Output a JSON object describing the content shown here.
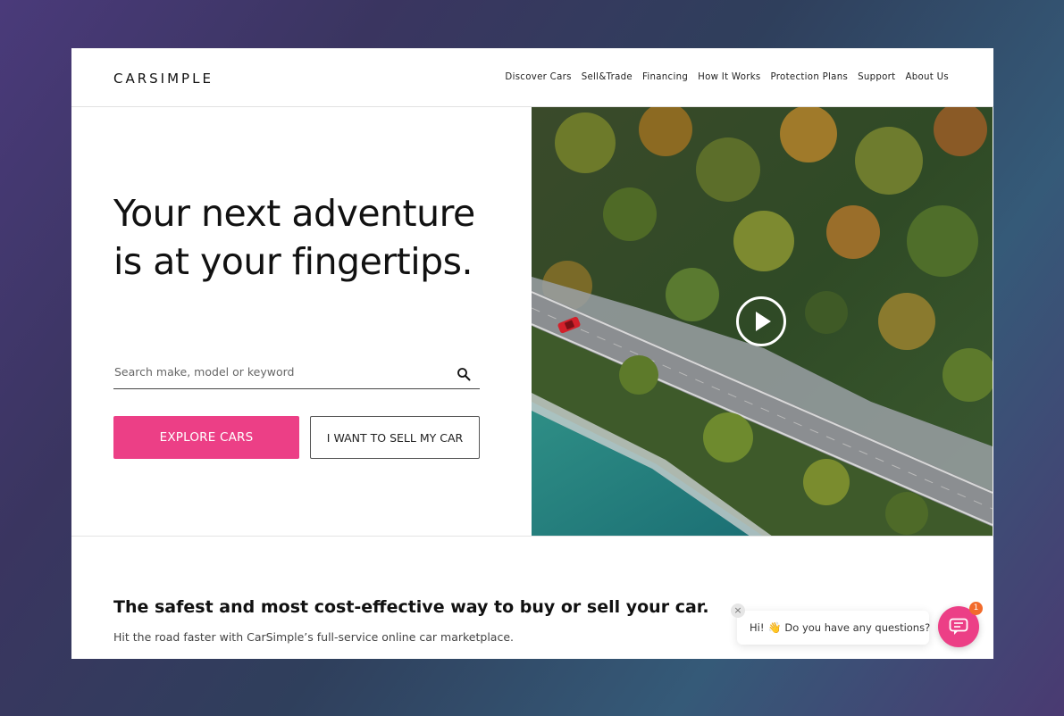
{
  "header": {
    "logo": "CARSIMPLE",
    "nav": [
      "Discover Cars",
      "Sell&Trade",
      "Financing",
      "How It Works",
      "Protection Plans",
      "Support",
      "About Us"
    ]
  },
  "hero": {
    "headline": "Your next adventure is at your fingertips.",
    "search": {
      "placeholder": "Search make, model or keyword",
      "value": ""
    },
    "explore_button": "EXPLORE CARS",
    "sell_button": "I WANT TO SELL MY CAR",
    "media": {
      "icon": "play-icon"
    }
  },
  "section": {
    "tagline": "The safest and most cost-effective way to buy or sell your car.",
    "subtext": "Hit the road faster with CarSimple’s full-service online car marketplace."
  },
  "chat": {
    "greeting_prefix": "Hi!",
    "greeting_emoji": "👋",
    "greeting_text": "Do you have any questions?",
    "badge_count": "1",
    "close_glyph": "×"
  },
  "colors": {
    "accent": "#ec3f86",
    "badge": "#f26b2b"
  }
}
